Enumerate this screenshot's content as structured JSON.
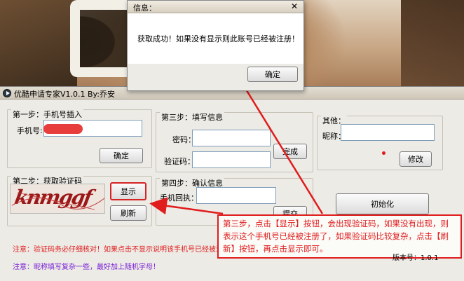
{
  "dialog": {
    "title": "信息：",
    "close_glyph": "✕",
    "message": "获取成功！如果没有显示则此账号已经被注册！",
    "ok_label": "确定"
  },
  "app": {
    "title": "优酷申请专家V1.0.1  By:乔安"
  },
  "step1": {
    "title": "第一步：手机号插入",
    "phone_label": "手机号:",
    "confirm_label": "确定"
  },
  "step2": {
    "title": "第二步：获取验证码",
    "captcha_text": "knmggf",
    "show_label": "显示",
    "refresh_label": "刷新"
  },
  "step3": {
    "title": "第三步：填写信息",
    "password_label": "密码：",
    "captcha_label": "验证码：",
    "finish_label": "完成"
  },
  "step4": {
    "title": "第四步：确认信息",
    "receipt_label": "手机回执：",
    "submit_label": "提交"
  },
  "other": {
    "title": "其他：",
    "nickname_label": "昵称：",
    "modify_label": "修改"
  },
  "init_label": "初始化",
  "notes": {
    "red": "注意：验证码务必仔细核对！如果点击不显示说明该手机号已经被注册！",
    "purple": "注意：昵称填写复杂一些，最好加上随机字母！"
  },
  "version": {
    "label": "版本号：",
    "value": "1.0.1"
  },
  "annotation": {
    "text": "第三步，点击【显示】按钮，会出现验证码，如果没有出现，则表示这个手机号已经被注册了，如果验证码比较复杂，点击【刷新】按钮，再点击显示即可。"
  },
  "colors": {
    "annotation_red": "#e01c1c",
    "note_red": "#e01c1c",
    "note_purple": "#7a1fd6"
  }
}
